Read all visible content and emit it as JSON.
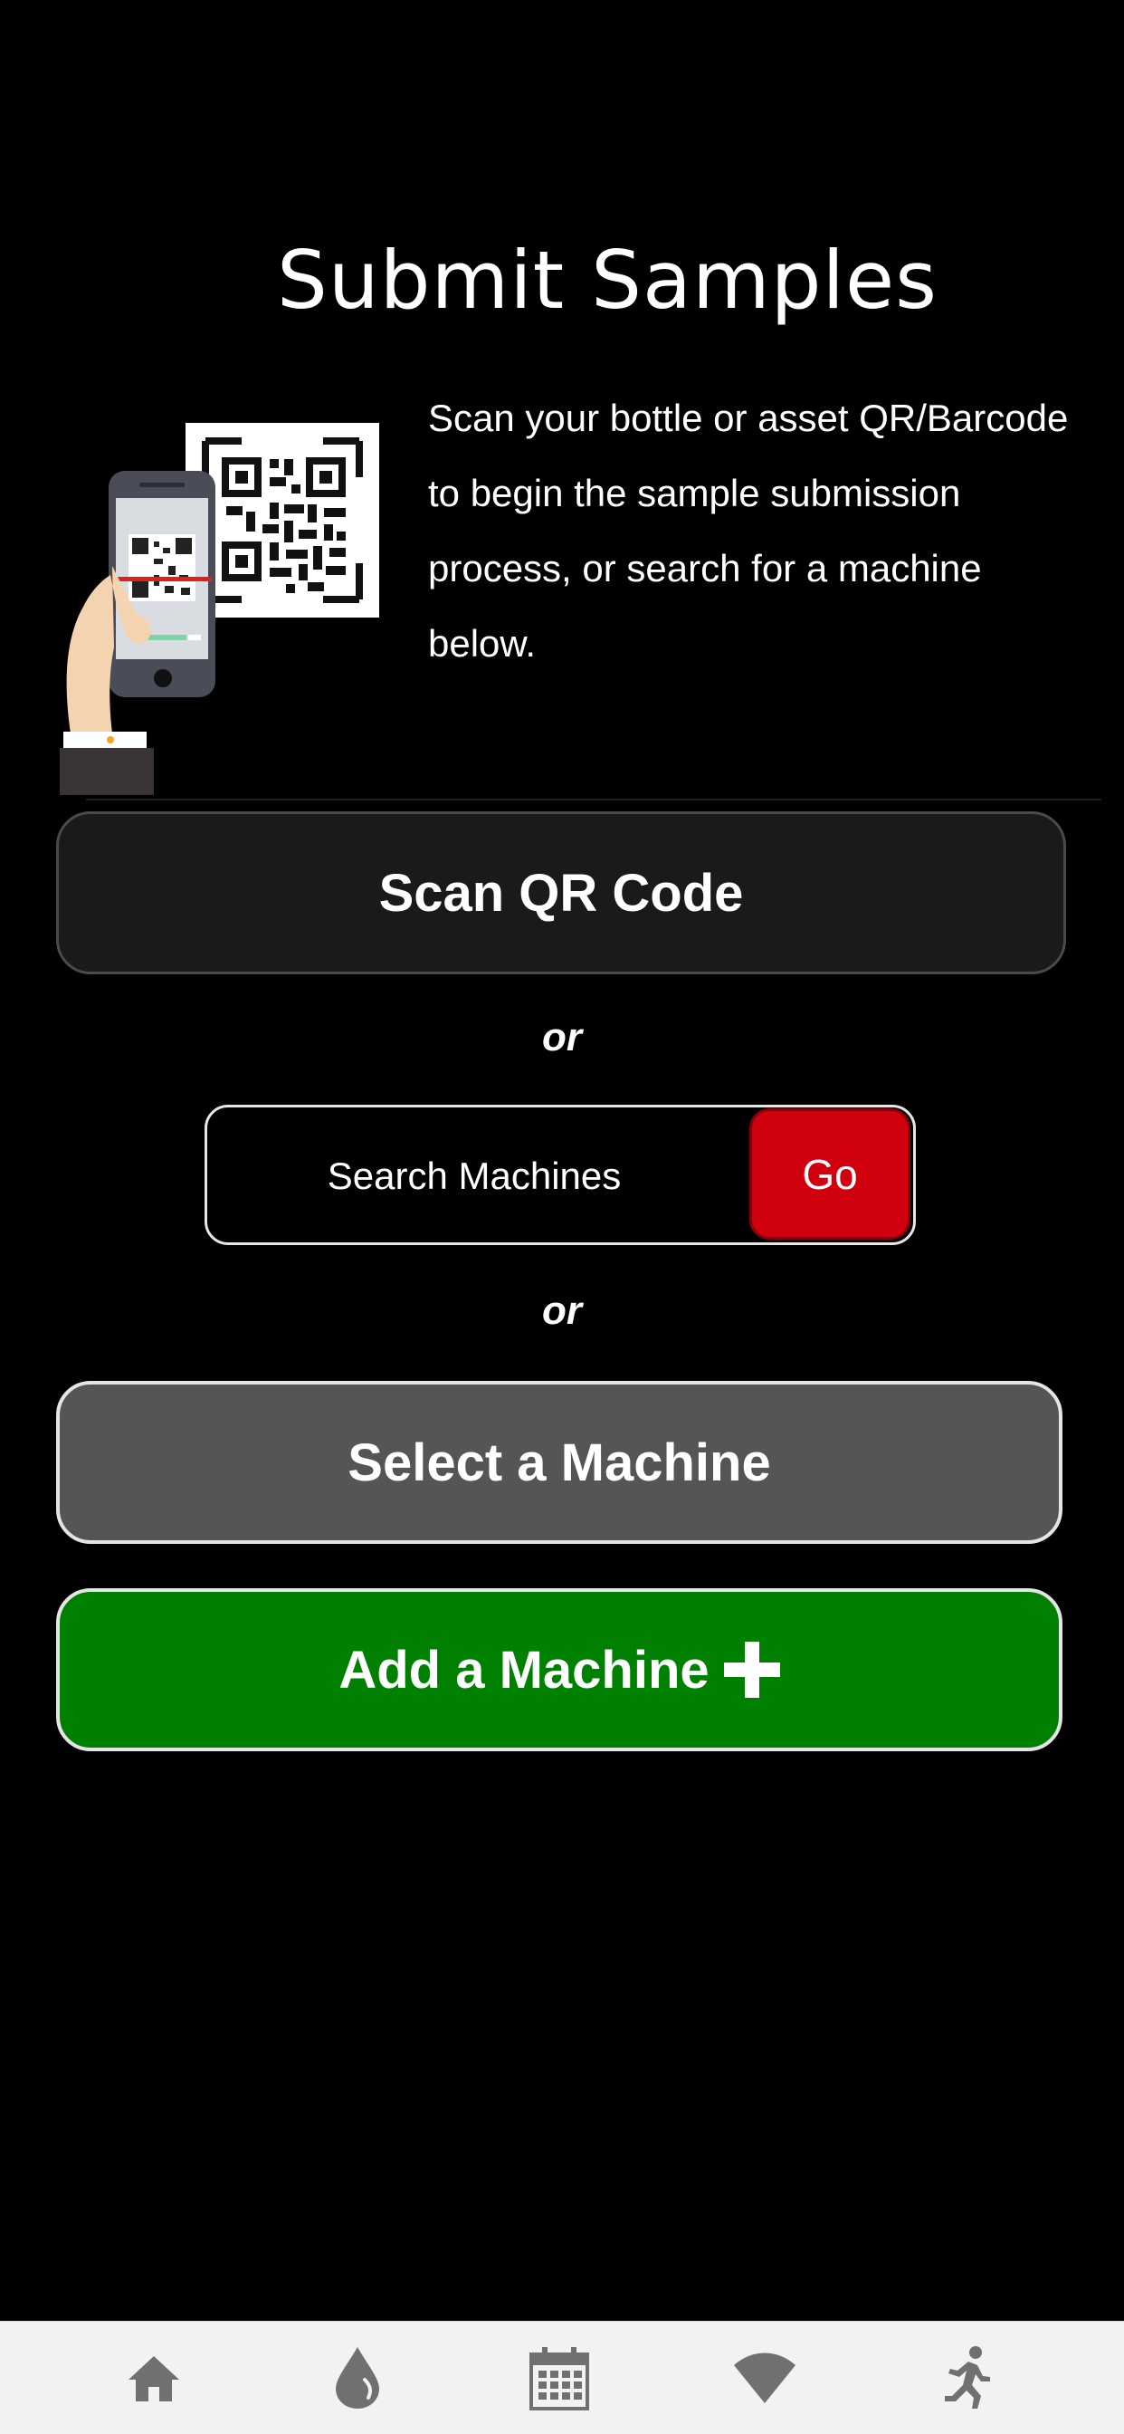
{
  "page": {
    "title": "Submit Samples",
    "intro": "Scan your bottle or asset QR/Barcode to begin the sample submission process, or search for a machine below."
  },
  "actions": {
    "scan_label": "Scan QR Code",
    "or_label": "or",
    "search_placeholder": "Search Machines",
    "go_label": "Go",
    "select_label": "Select a Machine",
    "add_label": "Add a Machine"
  },
  "colors": {
    "go_button": "#d0000f",
    "select_button": "#555557",
    "add_button": "#008000",
    "tab_icon": "#707070"
  },
  "tab_bar": {
    "items": [
      {
        "icon": "home-icon"
      },
      {
        "icon": "oil-drop-icon"
      },
      {
        "icon": "calendar-icon"
      },
      {
        "icon": "wifi-icon"
      },
      {
        "icon": "running-person-icon"
      }
    ]
  }
}
